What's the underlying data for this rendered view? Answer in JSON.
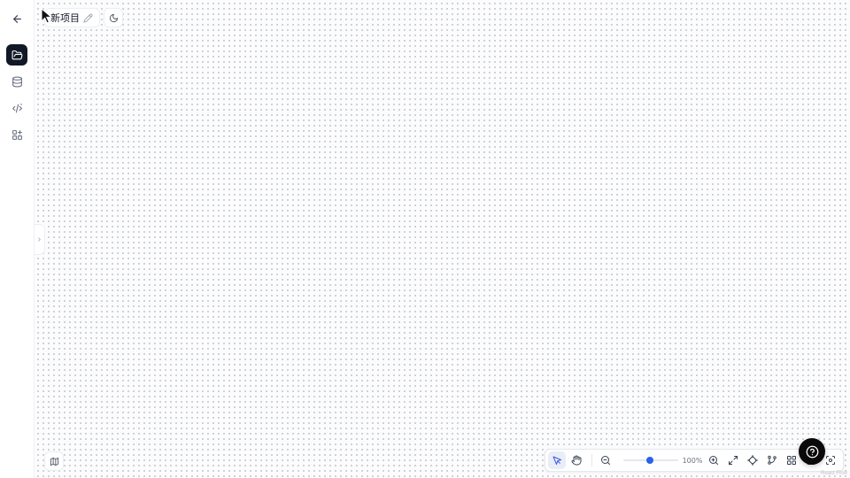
{
  "sidebar": {
    "items": [
      {
        "name": "back",
        "icon": "arrow-left-icon"
      },
      {
        "name": "projects",
        "icon": "folder-open-icon",
        "active": true
      },
      {
        "name": "database",
        "icon": "database-icon"
      },
      {
        "name": "code",
        "icon": "code-icon"
      },
      {
        "name": "components",
        "icon": "shapes-icon"
      }
    ]
  },
  "header": {
    "project_name": "新项目",
    "edit_icon": "pencil-icon",
    "theme_icon": "moon-icon"
  },
  "canvas": {
    "background": "#fcfcfd",
    "dot_color": "#b7bfcc"
  },
  "toolbar": {
    "zoom_level": "100%",
    "zoom_fraction": 0.48,
    "accent_color": "#2563eb"
  },
  "footer": {
    "attribution": "React Flow"
  },
  "colors": {
    "active_sidebar": "#111827",
    "help_button": "#0a0a0a"
  }
}
